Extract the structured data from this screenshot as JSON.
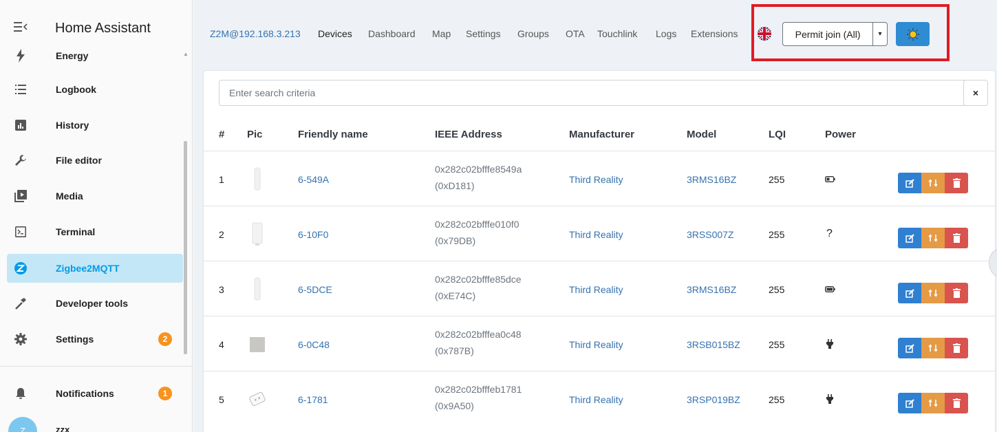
{
  "sidebar": {
    "title": "Home Assistant",
    "items": [
      {
        "label": "Energy",
        "icon": "lightning-icon"
      },
      {
        "label": "Logbook",
        "icon": "list-icon"
      },
      {
        "label": "History",
        "icon": "chart-icon"
      },
      {
        "label": "File editor",
        "icon": "wrench-icon"
      },
      {
        "label": "Media",
        "icon": "media-icon"
      },
      {
        "label": "Terminal",
        "icon": "terminal-icon"
      },
      {
        "label": "Zigbee2MQTT",
        "icon": "zigbee-icon",
        "active": true
      },
      {
        "label": "Developer tools",
        "icon": "hammer-icon"
      },
      {
        "label": "Settings",
        "icon": "gear-icon",
        "badge": "2"
      }
    ],
    "notifications": {
      "label": "Notifications",
      "badge": "1"
    },
    "user": {
      "initial": "Z",
      "name": "zzx"
    }
  },
  "topnav": {
    "brand": "Z2M@192.168.3.213",
    "links": [
      "Devices",
      "Dashboard",
      "Map",
      "Settings",
      "Groups",
      "OTA",
      "Touchlink",
      "Logs",
      "Extensions"
    ],
    "active": "Devices",
    "permit_join": "Permit join (All)"
  },
  "search": {
    "placeholder": "Enter search criteria",
    "clear": "×"
  },
  "table": {
    "headers": [
      "#",
      "Pic",
      "Friendly name",
      "IEEE Address",
      "Manufacturer",
      "Model",
      "LQI",
      "Power"
    ],
    "rows": [
      {
        "num": "1",
        "name": "6-549A",
        "ieee": "0x282c02bfffe8549a",
        "nwk": "(0xD181)",
        "manufacturer": "Third Reality",
        "model": "3RMS16BZ",
        "lqi": "255",
        "power": "battery-icon"
      },
      {
        "num": "2",
        "name": "6-10F0",
        "ieee": "0x282c02bfffe010f0",
        "nwk": "(0x79DB)",
        "manufacturer": "Third Reality",
        "model": "3RSS007Z",
        "lqi": "255",
        "power": "?"
      },
      {
        "num": "3",
        "name": "6-5DCE",
        "ieee": "0x282c02bfffe85dce",
        "nwk": "(0xE74C)",
        "manufacturer": "Third Reality",
        "model": "3RMS16BZ",
        "lqi": "255",
        "power": "battery-icon"
      },
      {
        "num": "4",
        "name": "6-0C48",
        "ieee": "0x282c02bfffea0c48",
        "nwk": "(0x787B)",
        "manufacturer": "Third Reality",
        "model": "3RSB015BZ",
        "lqi": "255",
        "power": "plug-icon"
      },
      {
        "num": "5",
        "name": "6-1781",
        "ieee": "0x282c02bfffeb1781",
        "nwk": "(0x9A50)",
        "manufacturer": "Third Reality",
        "model": "3RSP019BZ",
        "lqi": "255",
        "power": "plug-icon"
      }
    ]
  },
  "colors": {
    "accent": "#3572b0",
    "active_bg": "#c4e7f7",
    "highlight": "#e01b24",
    "badge": "#f7931e"
  }
}
